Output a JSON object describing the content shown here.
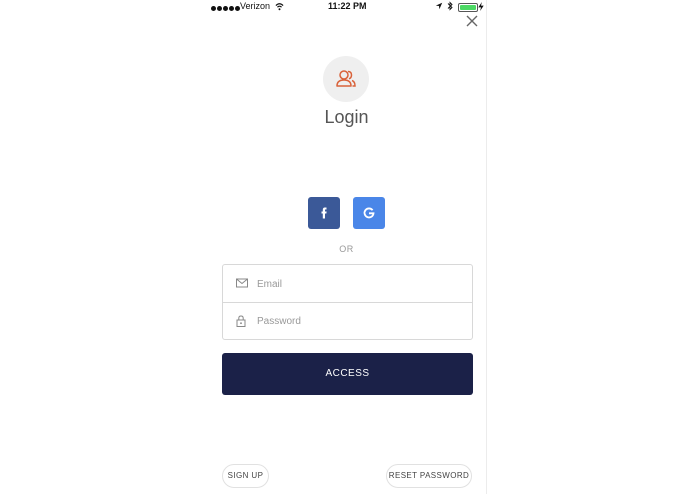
{
  "status_bar": {
    "carrier": "Verizon",
    "time": "11:22 PM",
    "signal_icon": "signal-dots-icon",
    "wifi_icon": "wifi-icon",
    "location_icon": "location-arrow-icon",
    "bluetooth_icon": "bluetooth-icon",
    "battery_icon": "battery-icon",
    "charging_icon": "charging-bolt-icon"
  },
  "header": {
    "close_icon": "close-icon",
    "avatar_icon": "user-group-icon",
    "title": "Login"
  },
  "social": {
    "facebook_icon": "facebook-icon",
    "google_icon": "google-icon",
    "facebook_color": "#3b5998",
    "google_color": "#4a86e8",
    "separator": "OR"
  },
  "form": {
    "email_placeholder": "Email",
    "password_placeholder": "Password",
    "email_icon": "envelope-icon",
    "password_icon": "lock-icon"
  },
  "actions": {
    "access_label": "ACCESS",
    "access_color": "#1b2148",
    "signup_label": "SIGN UP",
    "reset_label": "RESET PASSWORD"
  }
}
